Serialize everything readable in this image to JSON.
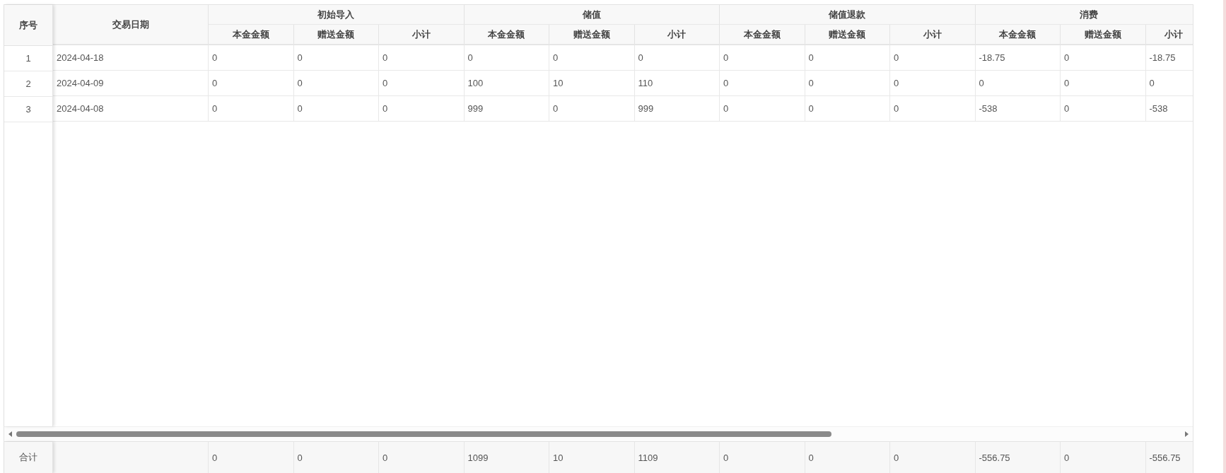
{
  "header": {
    "index": "序号",
    "date": "交易日期",
    "groups": [
      {
        "title": "初始导入",
        "columns": [
          "本金金额",
          "赠送金额",
          "小计"
        ]
      },
      {
        "title": "储值",
        "columns": [
          "本金金额",
          "赠送金额",
          "小计"
        ]
      },
      {
        "title": "储值退款",
        "columns": [
          "本金金额",
          "赠送金额",
          "小计"
        ]
      },
      {
        "title": "消费",
        "columns": [
          "本金金额",
          "赠送金额",
          "小计"
        ]
      }
    ]
  },
  "rows": [
    {
      "index": "1",
      "date": "2024-04-18",
      "values": [
        "0",
        "0",
        "0",
        "0",
        "0",
        "0",
        "0",
        "0",
        "0",
        "-18.75",
        "0",
        "-18.75"
      ]
    },
    {
      "index": "2",
      "date": "2024-04-09",
      "values": [
        "0",
        "0",
        "0",
        "100",
        "10",
        "110",
        "0",
        "0",
        "0",
        "0",
        "0",
        "0"
      ]
    },
    {
      "index": "3",
      "date": "2024-04-08",
      "values": [
        "0",
        "0",
        "0",
        "999",
        "0",
        "999",
        "0",
        "0",
        "0",
        "-538",
        "0",
        "-538"
      ]
    }
  ],
  "footer": {
    "label": "合计",
    "values": [
      "0",
      "0",
      "0",
      "1099",
      "10",
      "1109",
      "0",
      "0",
      "0",
      "-556.75",
      "0",
      "-556.75"
    ]
  }
}
